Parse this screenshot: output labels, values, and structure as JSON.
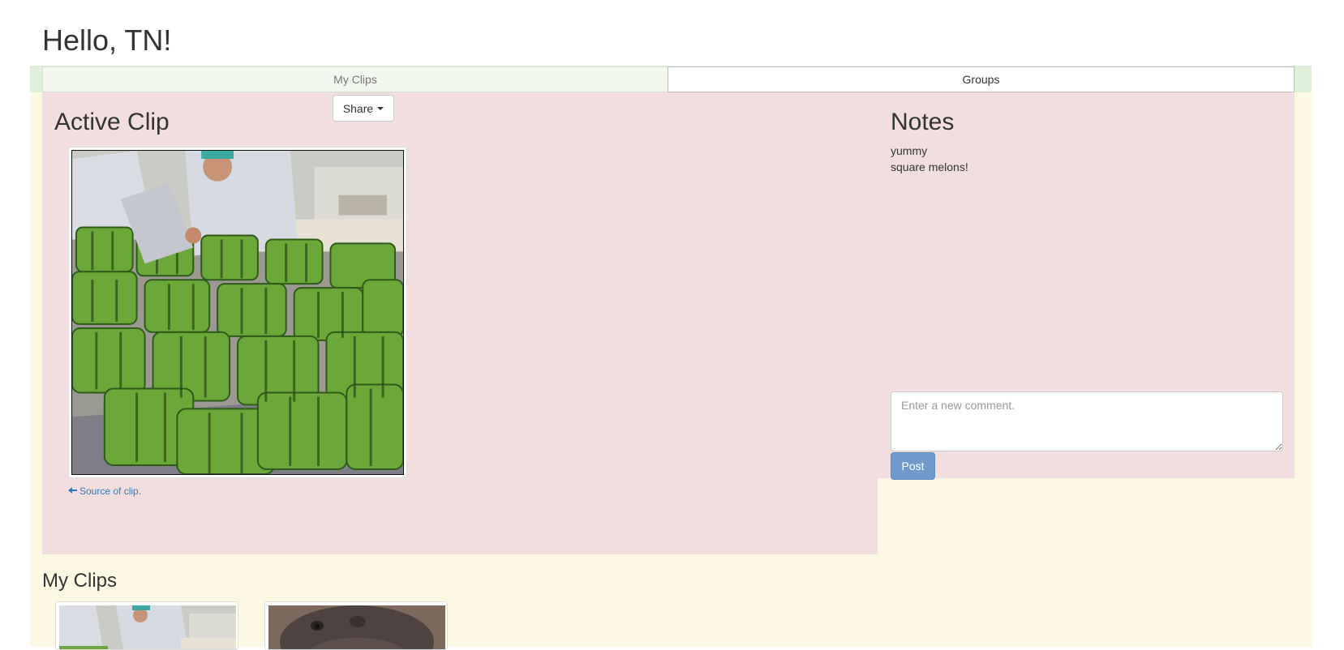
{
  "header": {
    "greeting": "Hello, TN!"
  },
  "tabs": [
    {
      "label": "My Clips",
      "active": false
    },
    {
      "label": "Groups",
      "active": true
    }
  ],
  "share": {
    "label": "Share"
  },
  "active_clip": {
    "title": "Active Clip",
    "image_icon": "square-watermelons-photo",
    "source_label": "Source of clip."
  },
  "notes": {
    "title": "Notes",
    "items": [
      "yummy",
      "square melons!"
    ],
    "comment_placeholder": "Enter a new comment.",
    "post_label": "Post"
  },
  "my_clips": {
    "title": "My Clips",
    "thumbnails": [
      "square-watermelons-thumbnail",
      "hippo-thumbnail"
    ]
  },
  "colors": {
    "tab_band": "#dff0d8",
    "panel": "#f2dede",
    "page_bg": "#fcf8e3",
    "link": "#337ab7",
    "post_button": "#6f9ac9"
  }
}
